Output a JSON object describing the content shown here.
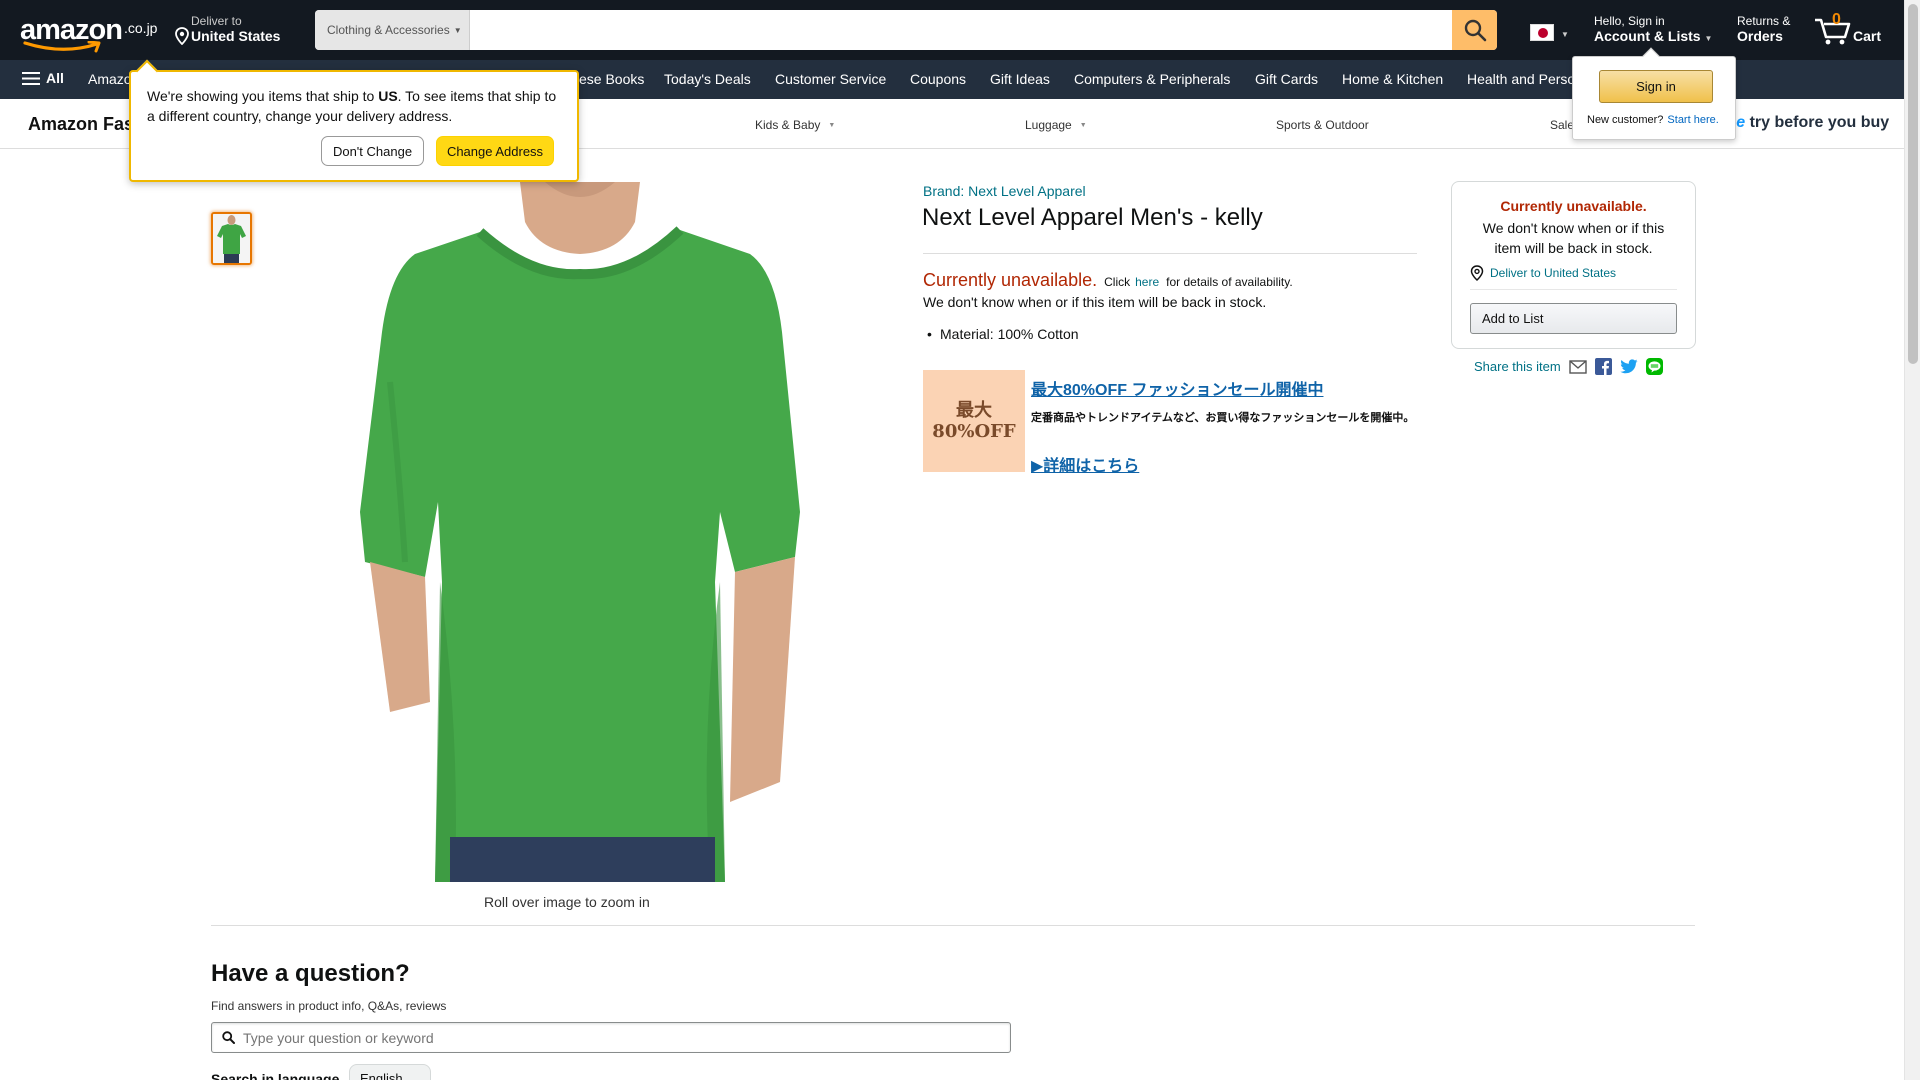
{
  "header": {
    "logo_text": "amazon",
    "logo_tld": ".co.jp",
    "deliver_line1": "Deliver to",
    "deliver_line2": "United States",
    "search_category": "Clothing & Accessories",
    "search_placeholder": "",
    "flag": "JP",
    "account_line1": "Hello, Sign in",
    "account_line2": "Account & Lists",
    "returns_line1": "Returns &",
    "returns_line2": "Orders",
    "cart_count": "0",
    "cart_label": "Cart"
  },
  "subnav": {
    "all_label": "All",
    "items": [
      "Amazo",
      "ese Books",
      "Today's Deals",
      "Customer Service",
      "Coupons",
      "Gift Ideas",
      "Computers & Peripherals",
      "Gift Cards",
      "Home & Kitchen",
      "Health and Perso"
    ]
  },
  "storebar": {
    "title": "Amazon Fas",
    "categories": [
      "Kids & Baby",
      "Luggage",
      "Sports & Outdoor",
      "Sale"
    ],
    "prime_prefix": "me",
    "prime_text": "try before you buy"
  },
  "popover": {
    "msg_before": "We're showing you items that ship to ",
    "msg_bold": "US",
    "msg_after": ". To see items that ship to a different country, change your delivery address.",
    "dont_change": "Don't Change",
    "change_address": "Change Address"
  },
  "signin_flyout": {
    "button": "Sign in",
    "new_customer": "New customer?",
    "start_here": "Start here."
  },
  "product": {
    "brand": "Brand: Next Level Apparel",
    "title": "Next Level Apparel Men's - kelly",
    "unavailable": "Currently unavailable.",
    "click": "Click",
    "here": "here",
    "details": "for details of availability.",
    "unavailable_sub": "We don't know when or if this item will be back in stock.",
    "bullets": [
      "Material: 100% Cotton"
    ],
    "rollover": "Roll over image to zoom in",
    "shirt_color": "#3fa544"
  },
  "promo": {
    "badge_line1": "最大",
    "badge_line2": "80%OFF",
    "headline": "最大80%OFF ファッションセール開催中",
    "desc": "定番商品やトレンドアイテムなど、お買い得なファッションセールを開催中。",
    "more": "▶詳細はこちら"
  },
  "buybox": {
    "unavailable": "Currently unavailable.",
    "sub": "We don't know when or if this item will be back in stock.",
    "deliver": "Deliver to United States",
    "add_to_list": "Add to List"
  },
  "share": {
    "label": "Share this item"
  },
  "qa": {
    "title": "Have a question?",
    "subtitle": "Find answers in product info, Q&As, reviews",
    "placeholder": "Type your question or keyword",
    "lang_label": "Search in language",
    "lang_value": "English"
  }
}
